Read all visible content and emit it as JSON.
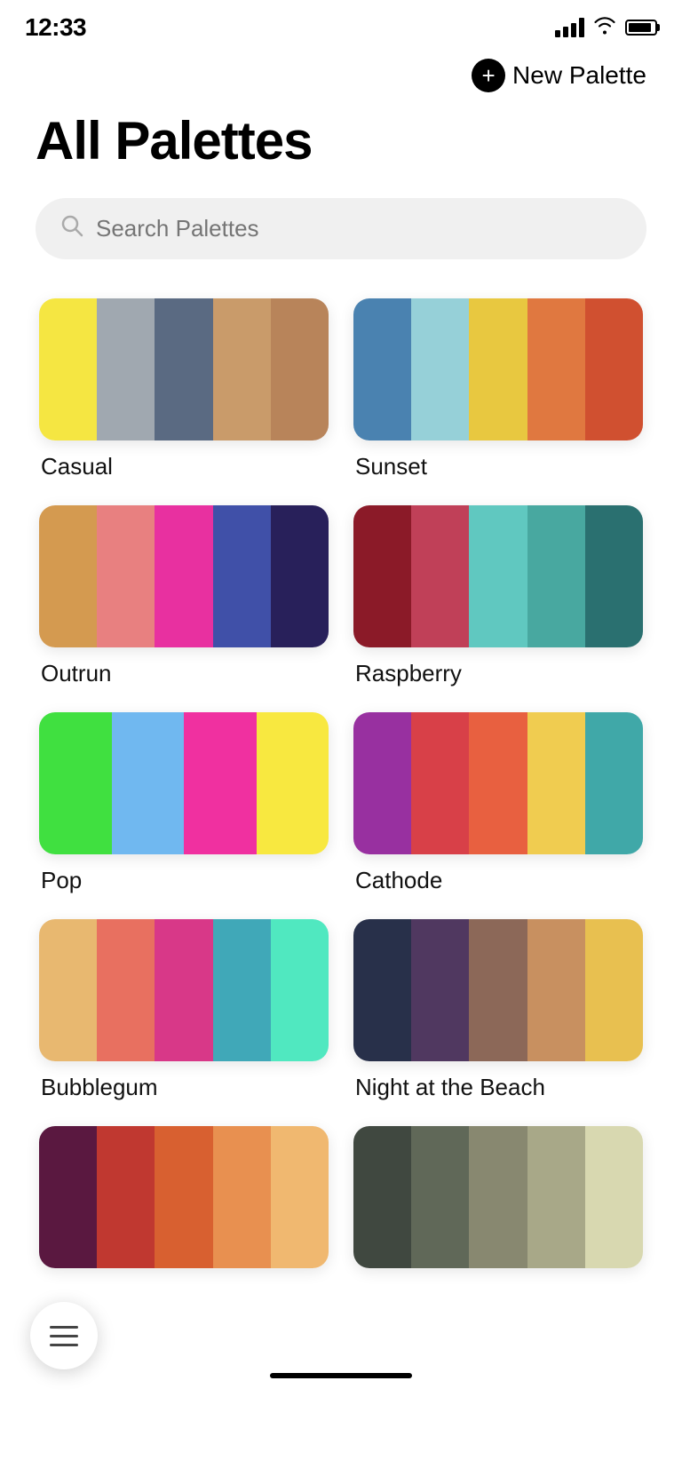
{
  "statusBar": {
    "time": "12:33",
    "location_icon": "location-arrow"
  },
  "header": {
    "new_palette_label": "New Palette",
    "new_palette_icon": "plus-circle-icon"
  },
  "page": {
    "title": "All Palettes"
  },
  "search": {
    "placeholder": "Search Palettes"
  },
  "palettes": [
    {
      "name": "Casual",
      "colors": [
        "#F5E642",
        "#A0A8B0",
        "#5A6A82",
        "#C99B6A",
        "#B8845A"
      ]
    },
    {
      "name": "Sunset",
      "colors": [
        "#4A82B0",
        "#96D0D8",
        "#E8C840",
        "#E07840",
        "#D05030"
      ]
    },
    {
      "name": "Outrun",
      "colors": [
        "#D49A50",
        "#E88080",
        "#E830A0",
        "#4050A8",
        "#28205A"
      ]
    },
    {
      "name": "Raspberry",
      "colors": [
        "#8B1A28",
        "#C04058",
        "#60C8C0",
        "#48A8A0",
        "#2A7070"
      ]
    },
    {
      "name": "Pop",
      "colors": [
        "#40E040",
        "#70B8F0",
        "#F030A0",
        "#F8E840"
      ]
    },
    {
      "name": "Cathode",
      "colors": [
        "#9830A0",
        "#D84048",
        "#E86040",
        "#F0CC50",
        "#40A8A8"
      ]
    },
    {
      "name": "Bubblegum",
      "colors": [
        "#E8B870",
        "#E87060",
        "#D83888",
        "#40A8B8",
        "#50E8C0"
      ]
    },
    {
      "name": "Night at the Beach",
      "colors": [
        "#28304A",
        "#503860",
        "#8C6858",
        "#C89060",
        "#E8C050"
      ]
    },
    {
      "name": "",
      "colors": [
        "#5A1840",
        "#C03830",
        "#D86030",
        "#E89050",
        "#F0B870"
      ]
    },
    {
      "name": "",
      "colors": [
        "#404840",
        "#606858",
        "#888870",
        "#A8A888",
        "#D8D8B0"
      ]
    }
  ],
  "menu": {
    "icon": "menu-icon"
  }
}
